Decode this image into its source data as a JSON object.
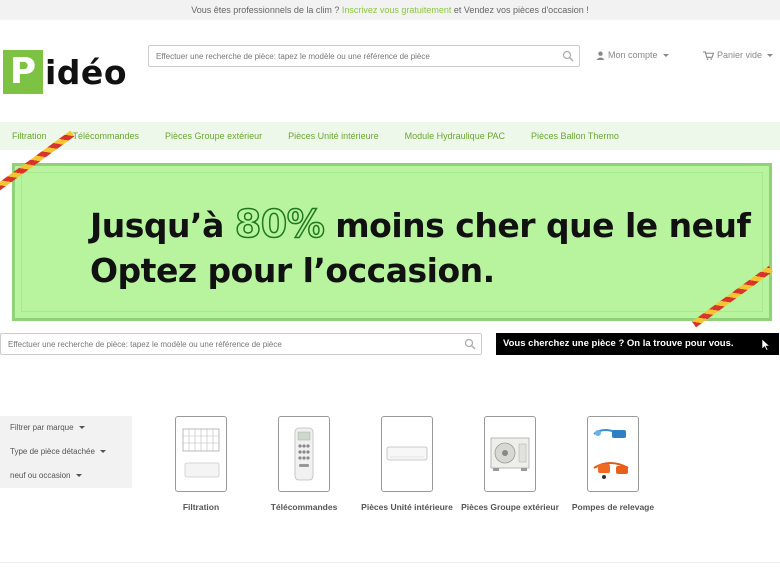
{
  "topbar": {
    "text_before": "Vous êtes professionnels de la clim ? ",
    "link": "Inscrivez vous gratuitement",
    "text_after": " et Vendez vos pièces d'occasion !"
  },
  "logo": {
    "first_letter": "P",
    "rest": "idéo"
  },
  "search": {
    "placeholder": "Effectuer une recherche de pièce: tapez le modèle ou une référence de pièce"
  },
  "account": {
    "label": "Mon compte"
  },
  "cart": {
    "label": "Panier vide"
  },
  "nav": {
    "items": [
      {
        "label": "Filtration"
      },
      {
        "label": "Télécommandes"
      },
      {
        "label": "Pièces Groupe extérieur"
      },
      {
        "label": "Pièces Unité intérieure"
      },
      {
        "label": "Module Hydraulique PAC"
      },
      {
        "label": "Pièces Ballon Thermo"
      }
    ]
  },
  "banner": {
    "line1_before": "Jusqu’à ",
    "line1_pct": "80%",
    "line1_after": " moins cher que le neuf",
    "line2": "Optez pour l’occasion."
  },
  "search2": {
    "placeholder": "Effectuer une recherche de pièce: tapez le modèle ou une référence de pièce"
  },
  "cta": {
    "label": "Vous cherchez une pièce ?  On la trouve pour vous."
  },
  "filters": [
    {
      "label": "Filtrer par marque"
    },
    {
      "label": "Type de pièce détachée"
    },
    {
      "label": "neuf ou occasion"
    }
  ],
  "categories": [
    {
      "label": "Filtration",
      "icon": "filter-icon"
    },
    {
      "label": "Télécommandes",
      "icon": "remote-icon"
    },
    {
      "label": "Pièces Unité intérieure",
      "icon": "indoor-unit-icon"
    },
    {
      "label": "Pièces Groupe extérieur",
      "icon": "outdoor-unit-icon"
    },
    {
      "label": "Pompes de relevage",
      "icon": "pump-icon"
    }
  ],
  "colors": {
    "accent": "#8cc63f",
    "banner_bg": "#b8f39e",
    "nav_bg": "#eef8ea"
  }
}
